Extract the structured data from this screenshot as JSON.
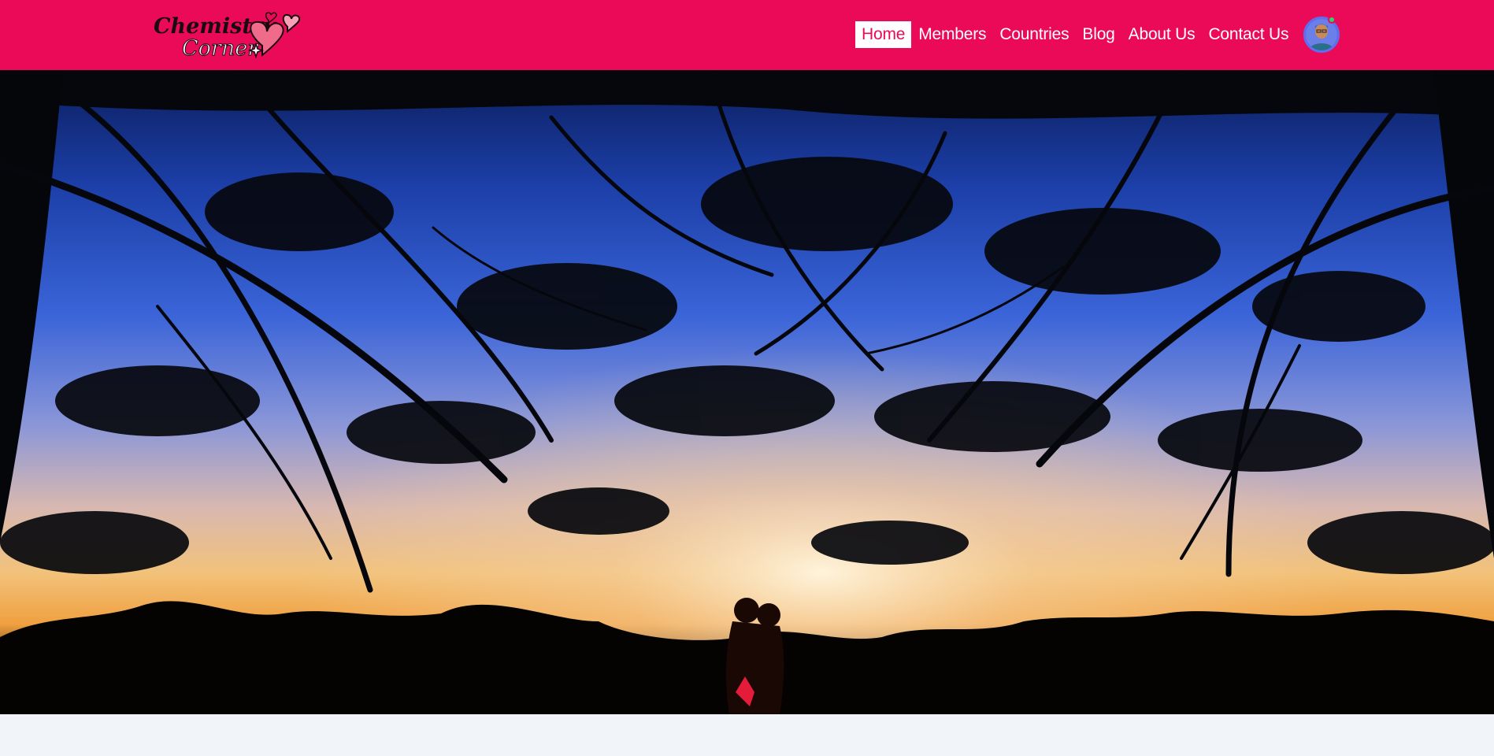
{
  "brand": {
    "logo_line1": "Chemistry",
    "logo_line2": "Corner",
    "primary_color": "#ea0a58"
  },
  "nav": {
    "items": [
      {
        "label": "Home",
        "active": true
      },
      {
        "label": "Members",
        "active": false
      },
      {
        "label": "Countries",
        "active": false
      },
      {
        "label": "Blog",
        "active": false
      },
      {
        "label": "About Us",
        "active": false
      },
      {
        "label": "Contact Us",
        "active": false
      }
    ],
    "avatar_icon": "user-avatar",
    "status": "online"
  },
  "hero": {
    "image": "couple-silhouette-under-trees-at-sunset"
  }
}
